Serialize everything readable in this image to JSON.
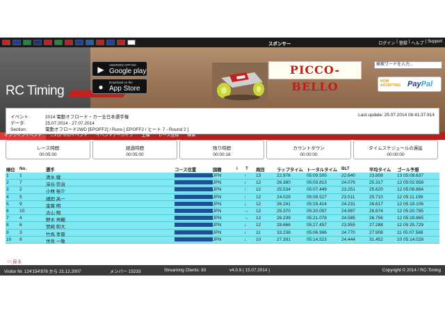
{
  "flags": [
    "#d02020",
    "#1f3fa0",
    "#1b8a3a",
    "#20307a",
    "#c42020",
    "#2a8a3a",
    "#c42020",
    "#1f3fa0",
    "#2060b0",
    "#c42020",
    "#1f3fa0",
    "#c42020",
    "#ffffff"
  ],
  "topbar": {
    "sponsor": "スポンサー",
    "links": [
      "ログイン",
      "|",
      "登録",
      "|",
      "ヘルプ",
      "|",
      "Support"
    ]
  },
  "header": {
    "logo": "RC Timing",
    "google_small": "ANDROID APP ON",
    "google_big": "Google play",
    "apple_small": "Download on the",
    "apple_big": "App Store",
    "sponsor_name": "PICCO-BELLO",
    "search_placeholder": "検索ワードを入力...",
    "paypal_now": "NOW",
    "paypal_accepting": "ACCEPTING",
    "paypal_pay": "Pay",
    "paypal_pal": "Pal"
  },
  "nav": [
    "オンラインイベント",
    "これからのイベント",
    "イベントアーカイブ",
    "主催",
    "レース登録",
    "検索"
  ],
  "event": {
    "event_label": "イベント:",
    "event_value": "2014 電動オフロード・カー全日本選手権",
    "data_label": "データ:",
    "data_value": "25.07.2014 - 27.07.2014",
    "section_label": "Section:",
    "section_value": "電動オフロード2WD [EPOFF2] / Runs [ EPOFF2 / ヒート 7 - Round 2 ]",
    "last_update": "Last update: 25.07.2014 06:41:37.814"
  },
  "stats": [
    {
      "title": "レース時間",
      "value": "00:05:00"
    },
    {
      "title": "経過時間",
      "value": "00:05:00"
    },
    {
      "title": "残り時間",
      "value": "00:00:16"
    },
    {
      "title": "カウントダウン",
      "value": "00:00:00"
    },
    {
      "title": "タイムスケジュールの遅延",
      "value": "00:00:00"
    }
  ],
  "table": {
    "headers": [
      "順位",
      "No.",
      "選手",
      "コース位置",
      "国籍",
      "i",
      "T",
      "周回",
      "ラップタイム",
      "トータルタイム",
      "BLT",
      "平均タイム",
      "ゴール予想"
    ],
    "rows": [
      {
        "pos": "1",
        "no": "1",
        "name": "清水 健",
        "country": "JPN",
        "trend": "↑",
        "laps": "13",
        "lap": "22.976",
        "total": "05:09.505",
        "blt": "22.640",
        "avg": "23.808",
        "goal": "13 05:09.637"
      },
      {
        "pos": "2",
        "no": "7",
        "name": "深谷 信治",
        "country": "JPN",
        "trend": "↓",
        "laps": "12",
        "lap": "26.380",
        "total": "05:03.813",
        "blt": "24.076",
        "avg": "25.317",
        "goal": "12 05:02.958"
      },
      {
        "pos": "3",
        "no": "2",
        "name": "小林 裕介",
        "country": "JPN",
        "trend": "↑",
        "laps": "12",
        "lap": "25.534",
        "total": "05:07.449",
        "blt": "23.251",
        "avg": "25.620",
        "goal": "12 05:09.864"
      },
      {
        "pos": "4",
        "no": "5",
        "name": "細田 高一",
        "country": "JPN",
        "trend": "↑",
        "laps": "12",
        "lap": "24.029",
        "total": "05:08.527",
        "blt": "23.511",
        "avg": "25.710",
        "goal": "12 05:11.199"
      },
      {
        "pos": "5",
        "no": "9",
        "name": "金賀 明",
        "country": "JPN",
        "trend": "↓",
        "laps": "12",
        "lap": "26.241",
        "total": "05:19.414",
        "blt": "24.231",
        "avg": "26.617",
        "goal": "12 05:19.106"
      },
      {
        "pos": "6",
        "no": "10",
        "name": "古山 翔",
        "country": "JPN",
        "trend": "→",
        "laps": "12",
        "lap": "25.370",
        "total": "05:20.097",
        "blt": "24.997",
        "avg": "26.674",
        "goal": "12 05:20.785"
      },
      {
        "pos": "7",
        "no": "4",
        "name": "野木 亮輔",
        "country": "JPN",
        "trend": "→",
        "laps": "12",
        "lap": "26.239",
        "total": "05:21.078",
        "blt": "24.585",
        "avg": "26.756",
        "goal": "12 05:19.865"
      },
      {
        "pos": "8",
        "no": "6",
        "name": "宮崎 和大",
        "country": "JPN",
        "trend": "↓",
        "laps": "12",
        "lap": "28.666",
        "total": "05:27.457",
        "blt": "23.955",
        "avg": "27.288",
        "goal": "12 05:25.729"
      },
      {
        "pos": "9",
        "no": "3",
        "name": "竹馬 孝晋",
        "country": "JPN",
        "trend": "↓",
        "laps": "11",
        "lap": "33.238",
        "total": "05:06.996",
        "blt": "24.770",
        "avg": "27.908",
        "goal": "11 05:07.588"
      },
      {
        "pos": "10",
        "no": "8",
        "name": "世良 一敬",
        "country": "JPN",
        "trend": "↓",
        "laps": "10",
        "lap": "27.391",
        "total": "05:14.523",
        "blt": "24.444",
        "avg": "31.452",
        "goal": "10 05:14.028"
      }
    ]
  },
  "back": "⇦ 戻る",
  "footer": {
    "visitor": "Visitor Nr. 124'154'876 から 21.12.2007",
    "members": "メンバー 15233",
    "streaming": "Streaming Clients: 83",
    "version": "v4.0.9 ( 15.07.2014 )",
    "copyright": "Copyright © 2014 / RC-Timing"
  },
  "colors": {
    "row": "#7fe8f2",
    "nav": "#b52020",
    "bar": "#1f4f96"
  }
}
